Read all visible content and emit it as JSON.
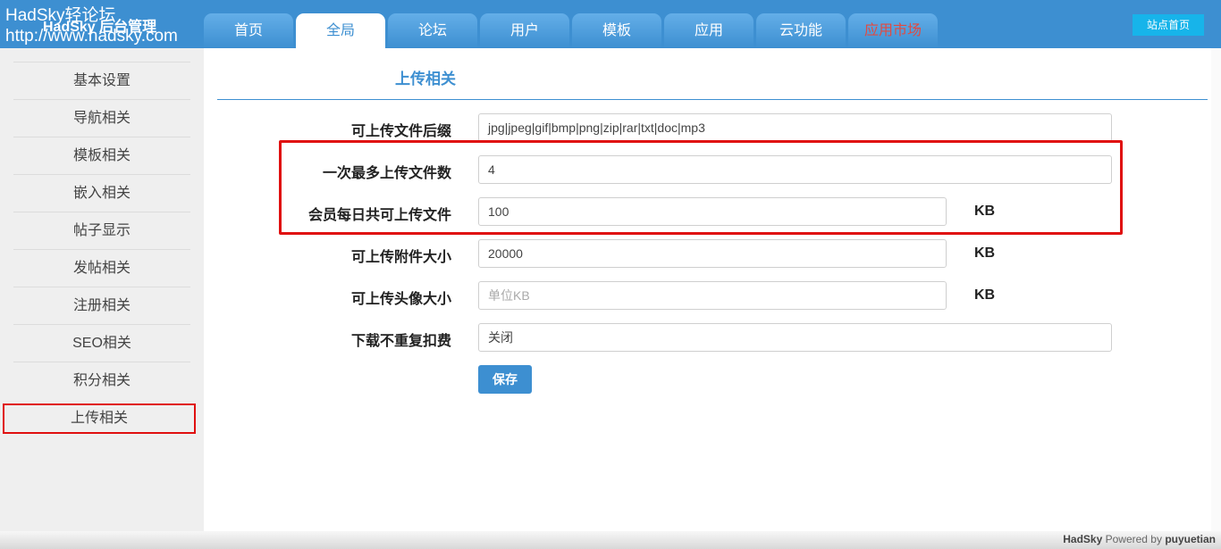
{
  "brand": {
    "title": "HadSky 后台管理",
    "overlay_line1": "HadSky轻论坛",
    "overlay_line2": "http://www.hadsky.com"
  },
  "nav": {
    "tabs": [
      {
        "label": "首页"
      },
      {
        "label": "全局"
      },
      {
        "label": "论坛"
      },
      {
        "label": "用户"
      },
      {
        "label": "模板"
      },
      {
        "label": "应用"
      },
      {
        "label": "云功能"
      },
      {
        "label": "应用市场"
      }
    ],
    "active_index": 1,
    "site_home_label": "站点首页"
  },
  "sidebar": {
    "items": [
      {
        "label": "基本设置"
      },
      {
        "label": "导航相关"
      },
      {
        "label": "模板相关"
      },
      {
        "label": "嵌入相关"
      },
      {
        "label": "帖子显示"
      },
      {
        "label": "发帖相关"
      },
      {
        "label": "注册相关"
      },
      {
        "label": "SEO相关"
      },
      {
        "label": "积分相关"
      },
      {
        "label": "上传相关"
      }
    ],
    "active_index": 9
  },
  "main": {
    "section_title": "上传相关",
    "fields": [
      {
        "label": "可上传文件后缀",
        "value": "jpg|jpeg|gif|bmp|png|zip|rar|txt|doc|mp3",
        "placeholder": "",
        "unit": ""
      },
      {
        "label": "一次最多上传文件数",
        "value": "4",
        "placeholder": "",
        "unit": ""
      },
      {
        "label": "会员每日共可上传文件",
        "value": "100",
        "placeholder": "",
        "unit": "KB"
      },
      {
        "label": "可上传附件大小",
        "value": "20000",
        "placeholder": "",
        "unit": "KB"
      },
      {
        "label": "可上传头像大小",
        "value": "",
        "placeholder": "单位KB",
        "unit": "KB"
      },
      {
        "label": "下载不重复扣费",
        "value": "关闭",
        "placeholder": "",
        "unit": ""
      }
    ],
    "save_label": "保存"
  },
  "footer": {
    "brand": "HadSky",
    "powered_by": "Powered by",
    "author": "puyuetian"
  },
  "colors": {
    "accent": "#3d8fd1",
    "highlight": "#e01010",
    "market_tab": "#e24a40",
    "site_home_button": "#17b4ea"
  }
}
